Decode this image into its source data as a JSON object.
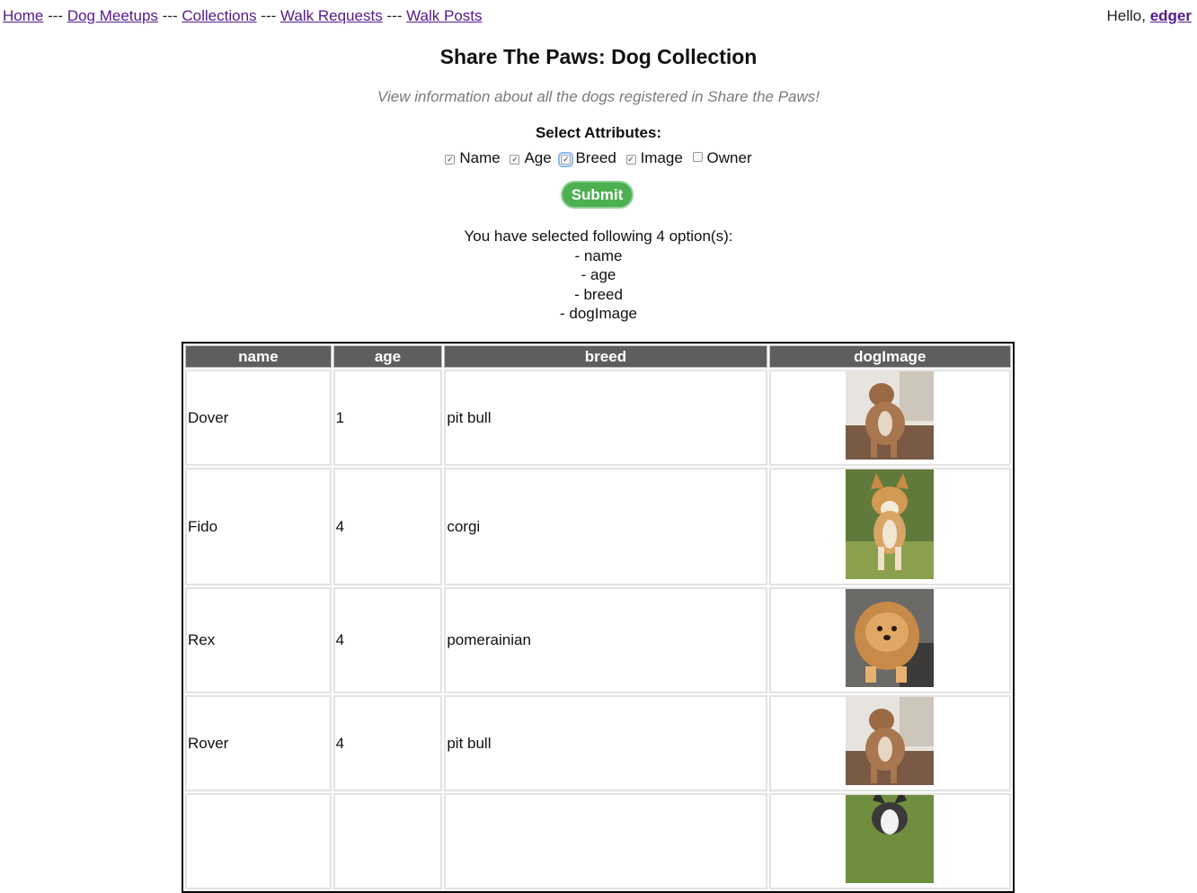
{
  "nav": {
    "links": [
      "Home",
      "Dog Meetups",
      "Collections",
      "Walk Requests",
      "Walk Posts"
    ],
    "separator": "---",
    "greeting": "Hello,",
    "username": "edger"
  },
  "page": {
    "title": "Share The Paws: Dog Collection",
    "subtitle": "View information about all the dogs registered in Share the Paws!"
  },
  "attributes": {
    "title": "Select Attributes:",
    "options": [
      {
        "label": "Name",
        "checked": true
      },
      {
        "label": "Age",
        "checked": true
      },
      {
        "label": "Breed",
        "checked": true,
        "focused": true
      },
      {
        "label": "Image",
        "checked": true
      },
      {
        "label": "Owner",
        "checked": false
      }
    ],
    "submit_label": "Submit"
  },
  "selection": {
    "summary": "You have selected following 4 option(s):",
    "items": [
      "- name",
      "- age",
      "- breed",
      "- dogImage"
    ]
  },
  "table": {
    "headers": [
      "name",
      "age",
      "breed",
      "dogImage"
    ],
    "rows": [
      {
        "name": "Dover",
        "age": "1",
        "breed": "pit bull",
        "image": "pit-bull-photo"
      },
      {
        "name": "Fido",
        "age": "4",
        "breed": "corgi",
        "image": "corgi-photo"
      },
      {
        "name": "Rex",
        "age": "4",
        "breed": "pomerainian",
        "image": "pomeranian-photo"
      },
      {
        "name": "Rover",
        "age": "4",
        "breed": "pit bull",
        "image": "pit-bull-photo"
      },
      {
        "name": "",
        "age": "",
        "breed": "",
        "image": "husky-photo"
      }
    ]
  },
  "colors": {
    "link": "#551a8b",
    "header_bg": "#5e5e5e",
    "submit_bg": "#4caf50",
    "subtitle": "#7a7a7a"
  }
}
